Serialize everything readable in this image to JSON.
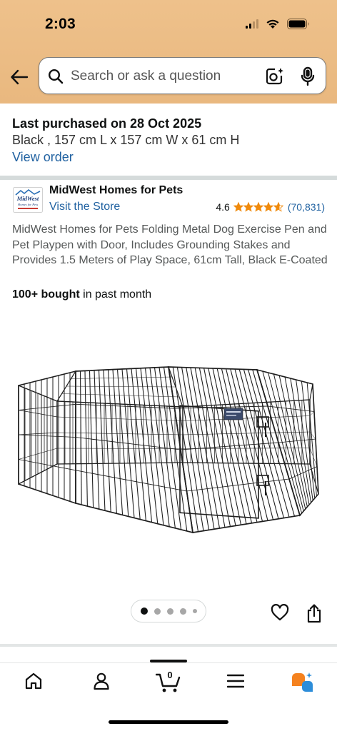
{
  "status_bar": {
    "time": "2:03"
  },
  "search": {
    "placeholder": "Search or ask a question"
  },
  "purchase": {
    "title": "Last purchased on 28 Oct 2025",
    "variant": "Black , 157 cm L x 157 cm W x 61 cm H",
    "view_order": "View order"
  },
  "product": {
    "brand": "MidWest Homes for Pets",
    "brand_logo_text": "MidWest Homes for Pets",
    "visit_store": "Visit the Store",
    "rating_value": "4.6",
    "rating_stars": 4.6,
    "rating_count": "(70,831)",
    "title": "MidWest Homes for Pets Folding Metal Dog Exercise Pen and Pet Playpen with Door, Includes Grounding Stakes and Provides 1.5 Meters of Play Space, 61cm Tall, Black E-Coated",
    "bought_bold": "100+ bought",
    "bought_rest": " in past month",
    "image_count": 5,
    "active_image": 1
  },
  "bottom_nav": {
    "items": [
      "home-icon",
      "account-icon",
      "cart-icon",
      "menu-icon",
      "rufus-icon"
    ],
    "cart_count": "0"
  },
  "colors": {
    "header_bg": "#e9b87f",
    "link": "#2162a1",
    "star": "#f08a0c",
    "rufus_orange": "#f5821f",
    "rufus_blue": "#2d8dd9"
  }
}
